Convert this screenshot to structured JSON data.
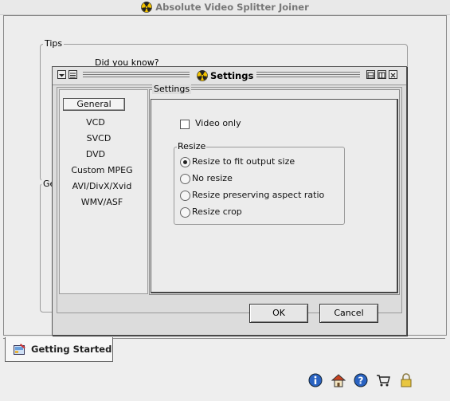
{
  "app": {
    "title": "Absolute Video Splitter Joiner"
  },
  "main": {
    "tips_group": "Tips",
    "tips_text": "Did you know?",
    "second_group_fragment": "Ge"
  },
  "tabs": [
    {
      "label": "Getting Started"
    }
  ],
  "toolbar_icons": [
    "info-icon",
    "home-icon",
    "help-icon",
    "cart-icon",
    "lock-icon"
  ],
  "settings": {
    "title": "Settings",
    "categories": [
      "General",
      "VCD",
      "SVCD",
      "DVD",
      "Custom MPEG",
      "AVI/DivX/Xvid",
      "WMV/ASF"
    ],
    "selected_category": "General",
    "panel_title": "Settings",
    "video_only_label": "Video only",
    "video_only_checked": false,
    "resize_group": "Resize",
    "resize_options": [
      "Resize to fit output size",
      "No resize",
      "Resize preserving aspect ratio",
      "Resize crop"
    ],
    "resize_selected": "Resize to fit output size",
    "ok_label": "OK",
    "cancel_label": "Cancel"
  },
  "colors": {
    "window_bg": "#eeeeee",
    "dialog_bg": "#dcdcdc",
    "info_icon": "#1f5fbf"
  }
}
